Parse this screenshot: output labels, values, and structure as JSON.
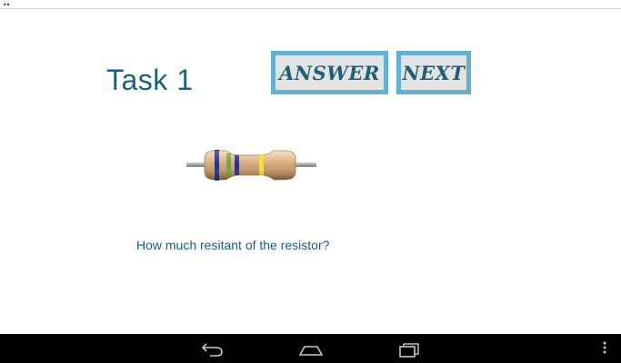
{
  "task": {
    "title": "Task 1"
  },
  "buttons": {
    "answer_label": "ANSWER",
    "next_label": "NEXT"
  },
  "question": {
    "text": "How much resitant of the resistor?"
  },
  "resistor": {
    "bands": [
      "#2a2f7a",
      "#6ea53a",
      "#2a2f7a",
      "#f3e21a"
    ],
    "body_color": "#d8ae7e"
  },
  "status_bar": {
    "indicator": "••"
  },
  "nav_bar": {
    "icons": [
      "back-icon",
      "home-icon",
      "recents-icon",
      "menu-icon"
    ]
  },
  "colors": {
    "accent_border": "#64b0cf",
    "text_primary": "#1c5f78",
    "button_bg": "#e3e3e3",
    "nav_bg": "#000000"
  }
}
